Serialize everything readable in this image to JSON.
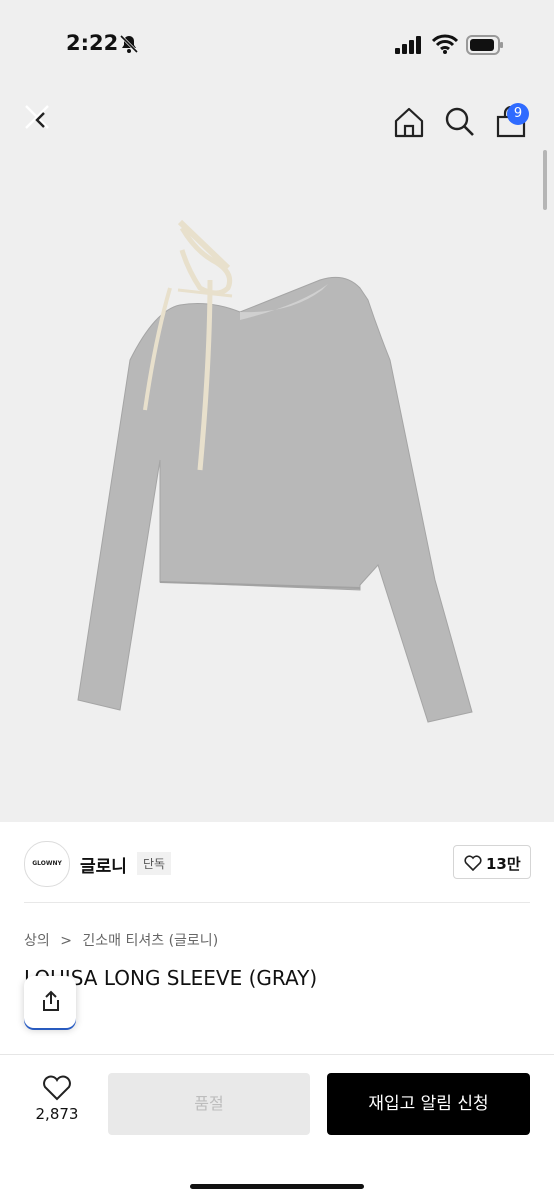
{
  "status": {
    "time": "2:22"
  },
  "nav": {
    "cart_count": "9"
  },
  "brand": {
    "logo_text": "GLOWNY",
    "name": "글로니",
    "tag": "단독",
    "likes": "13만"
  },
  "breadcrumb": {
    "category": "상의",
    "separator": ">",
    "subcategory": "긴소매 티셔츠 (글로니)"
  },
  "product": {
    "title": "LOUISA LONG SLEEVE (GRAY)"
  },
  "bottom": {
    "wish_count": "2,873",
    "soldout_label": "품절",
    "restock_label": "재입고 알림 신청"
  }
}
